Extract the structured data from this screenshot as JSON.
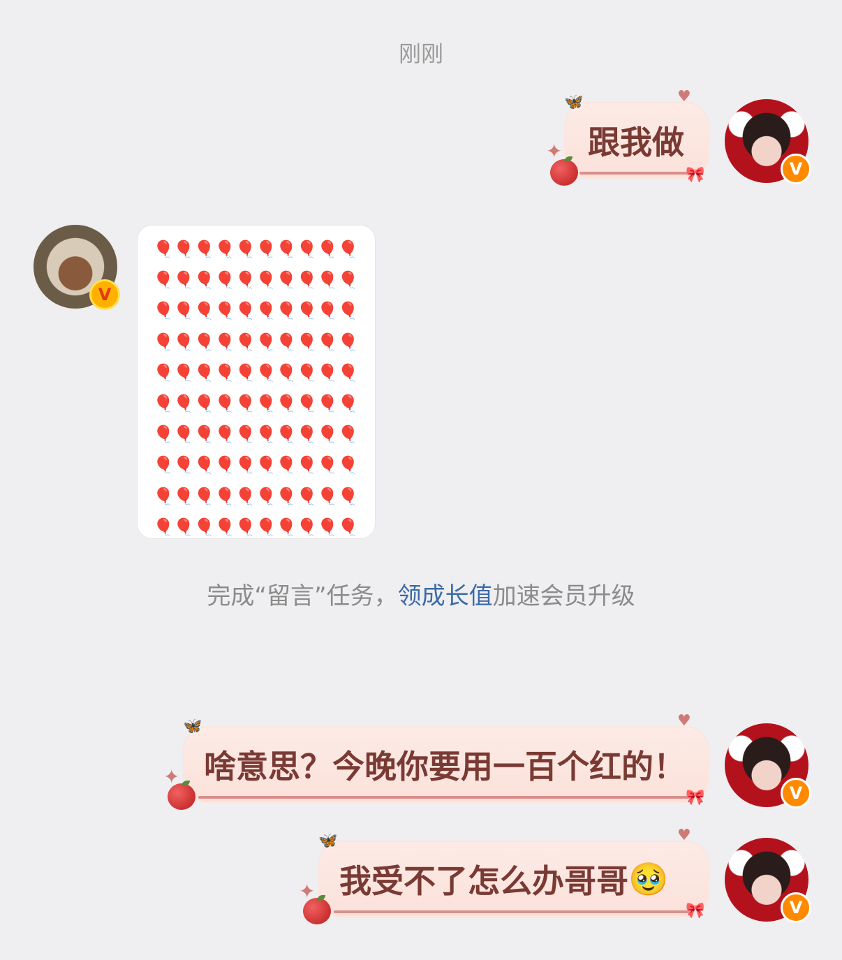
{
  "timestamp": "刚刚",
  "messages": [
    {
      "side": "right",
      "text": "跟我做",
      "badge": "V"
    },
    {
      "side": "left",
      "type": "sticker",
      "glyph": "🎈",
      "rows": 10,
      "cols": 10,
      "badge": "V"
    },
    {
      "side": "right",
      "text": "啥意思？今晚你要用一百个红的！",
      "badge": "V"
    },
    {
      "side": "right",
      "text": "我受不了怎么办哥哥",
      "emoji": "🥹",
      "badge": "V"
    }
  ],
  "system_notice": {
    "prefix": "完成“留言”任务，",
    "link": "领成长值",
    "suffix": "加速会员升级"
  },
  "colors": {
    "background": "#efeef0",
    "bubble": "#fdebe6",
    "bubble_text": "#7a3a34",
    "link": "#3b6aa8",
    "vip_badge": "#ff8a00"
  }
}
